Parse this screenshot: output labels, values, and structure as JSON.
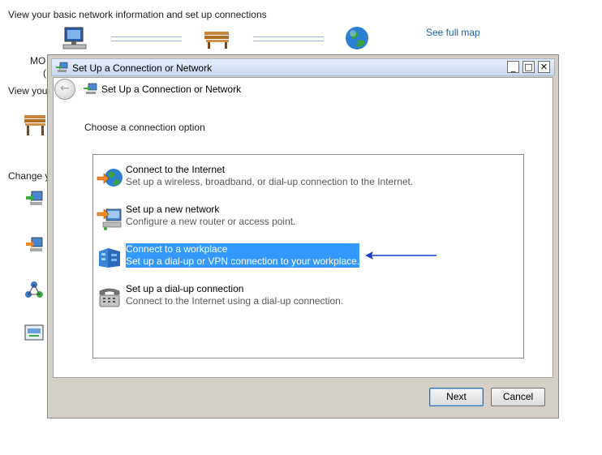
{
  "background": {
    "heading": "View your basic network information and set up connections",
    "see_full_map": "See full map",
    "frag_computer_name": "MO",
    "frag_paren": "(",
    "frag_view": "View you",
    "frag_change": "Change y"
  },
  "dialog": {
    "window_title": "Set Up a Connection or Network",
    "window_buttons": {
      "minimize": "_",
      "maximize": "□",
      "close": "✕"
    },
    "nav": {
      "back": "←",
      "title": "Set Up a Connection or Network"
    },
    "instruction": "Choose a connection option",
    "options": [
      {
        "title": "Connect to the Internet",
        "description": "Set up a wireless, broadband, or dial-up connection to the Internet.",
        "icon": "globe-internet-icon",
        "selected": false
      },
      {
        "title": "Set up a new network",
        "description": "Configure a new router or access point.",
        "icon": "new-network-icon",
        "selected": false
      },
      {
        "title": "Connect to a workplace",
        "description": "Set up a dial-up or VPN connection to your workplace.",
        "icon": "workplace-building-icon",
        "selected": true
      },
      {
        "title": "Set up a dial-up connection",
        "description": "Connect to the Internet using a dial-up connection.",
        "icon": "dialup-phone-icon",
        "selected": false
      }
    ],
    "buttons": {
      "next": "Next",
      "cancel": "Cancel"
    }
  },
  "colors": {
    "selection": "#3399ff",
    "link": "#1c5fae",
    "annotation_arrow": "#1a3fc6"
  }
}
